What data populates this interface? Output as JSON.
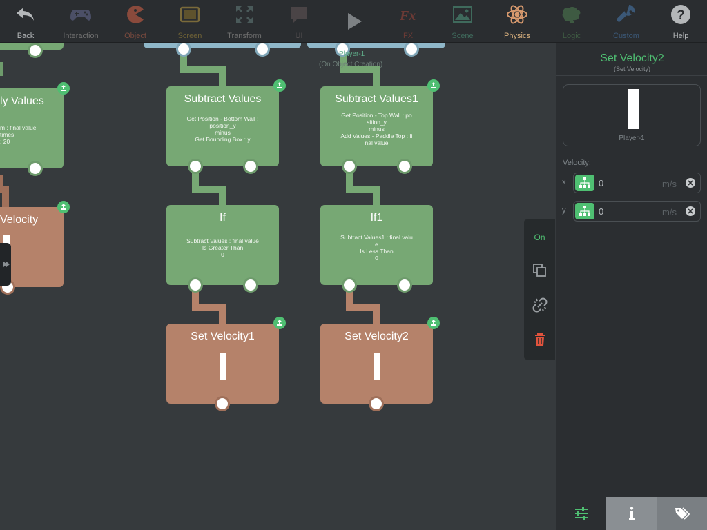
{
  "toolbar": {
    "items": [
      {
        "label": "Back",
        "icon": "back-arrow-icon",
        "active": true
      },
      {
        "label": "Interaction",
        "icon": "gamepad-icon",
        "active": false
      },
      {
        "label": "Object",
        "icon": "pacman-icon",
        "active": false
      },
      {
        "label": "Screen",
        "icon": "tablet-icon",
        "active": false
      },
      {
        "label": "Transform",
        "icon": "expand-arrows-icon",
        "active": false
      },
      {
        "label": "UI",
        "icon": "speech-bubble-icon",
        "active": false
      },
      {
        "label": "",
        "icon": "play-icon",
        "active": false
      },
      {
        "label": "FX",
        "icon": "fx-text-icon",
        "active": false
      },
      {
        "label": "Scene",
        "icon": "landscape-image-icon",
        "active": false
      },
      {
        "label": "Physics",
        "icon": "atom-icon",
        "active": true
      },
      {
        "label": "Logic",
        "icon": "brain-icon",
        "active": false
      },
      {
        "label": "Custom",
        "icon": "wrench-icon",
        "active": false
      },
      {
        "label": "Help",
        "icon": "question-circle-icon",
        "active": true
      }
    ]
  },
  "canvas": {
    "player_label": "Player-1",
    "player_sublabel": "(On Object Creation)",
    "blocks": {
      "multiply": {
        "title": "ly Values",
        "body": [
          "m : final value",
          "times",
          ": 20"
        ]
      },
      "velocity_left": {
        "title": "Velocity"
      },
      "subtract": {
        "title": "Subtract Values",
        "body": [
          "Get Position - Bottom Wall :",
          "position_y",
          "minus",
          "Get Bounding Box : y"
        ]
      },
      "subtract1": {
        "title": "Subtract Values1",
        "body": [
          "Get Position - Top Wall : po",
          "sition_y",
          "minus",
          "Add Values - Paddle Top : fi",
          "nal value"
        ]
      },
      "if": {
        "title": "If",
        "body": [
          "Subtract Values : final value",
          "Is Greater Than",
          "0"
        ]
      },
      "if1": {
        "title": "If1",
        "body": [
          "Subtract Values1 : final valu",
          "e",
          "Is Less Than",
          "0"
        ]
      },
      "set_velocity1": {
        "title": "Set Velocity1"
      },
      "set_velocity2": {
        "title": "Set Velocity2"
      }
    }
  },
  "context_bar": {
    "on_label": "On"
  },
  "panel": {
    "title": "Set Velocity2",
    "subtitle": "(Set Velocity)",
    "preview_label": "Player-1",
    "velocity_label": "Velocity:",
    "axes": [
      {
        "name": "x",
        "value": "0",
        "unit": "m/s"
      },
      {
        "name": "y",
        "value": "0",
        "unit": "m/s"
      }
    ]
  },
  "colors": {
    "accent": "#4fbf72",
    "green_block": "#77a874",
    "brown_block": "#b5826a",
    "blue_block": "#8fb7c9",
    "physics_active": "#d89a6e",
    "danger": "#e0533d"
  }
}
